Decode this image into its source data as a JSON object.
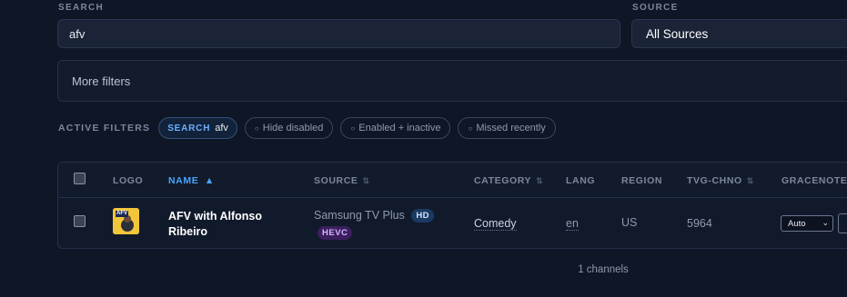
{
  "search": {
    "label": "SEARCH",
    "value": "afv"
  },
  "source": {
    "label": "SOURCE",
    "selected": "All Sources"
  },
  "more_filters": {
    "label": "More filters"
  },
  "active_filters": {
    "label": "ACTIVE FILTERS",
    "search_chip": {
      "key": "SEARCH",
      "value": "afv"
    },
    "chips": [
      "Hide disabled",
      "Enabled + inactive",
      "Missed recently"
    ]
  },
  "table": {
    "headers": {
      "logo": "LOGO",
      "name": "NAME",
      "name_sort": "▲",
      "source": "SOURCE",
      "category": "CATEGORY",
      "lang": "LANG",
      "region": "REGION",
      "tvg_chno": "TVG-CHNO",
      "gracenote": "GRACENOTE I",
      "sort_icon": "⇅"
    },
    "rows": [
      {
        "name": "AFV with Alfonso Ribeiro",
        "source": "Samsung TV Plus",
        "badges": {
          "hd": "HD",
          "hevc": "HEVC"
        },
        "category": "Comedy",
        "lang": "en",
        "region": "US",
        "tvg_chno": "5964",
        "gracenote_mode": "Auto",
        "logo_text": "AFV"
      }
    ]
  },
  "footer": {
    "count": "1 channels"
  },
  "colors": {
    "accent": "#4aa3ff",
    "background": "#0f1626",
    "hd_badge": "#1a3a64",
    "hevc_badge": "#3b1f5e"
  }
}
